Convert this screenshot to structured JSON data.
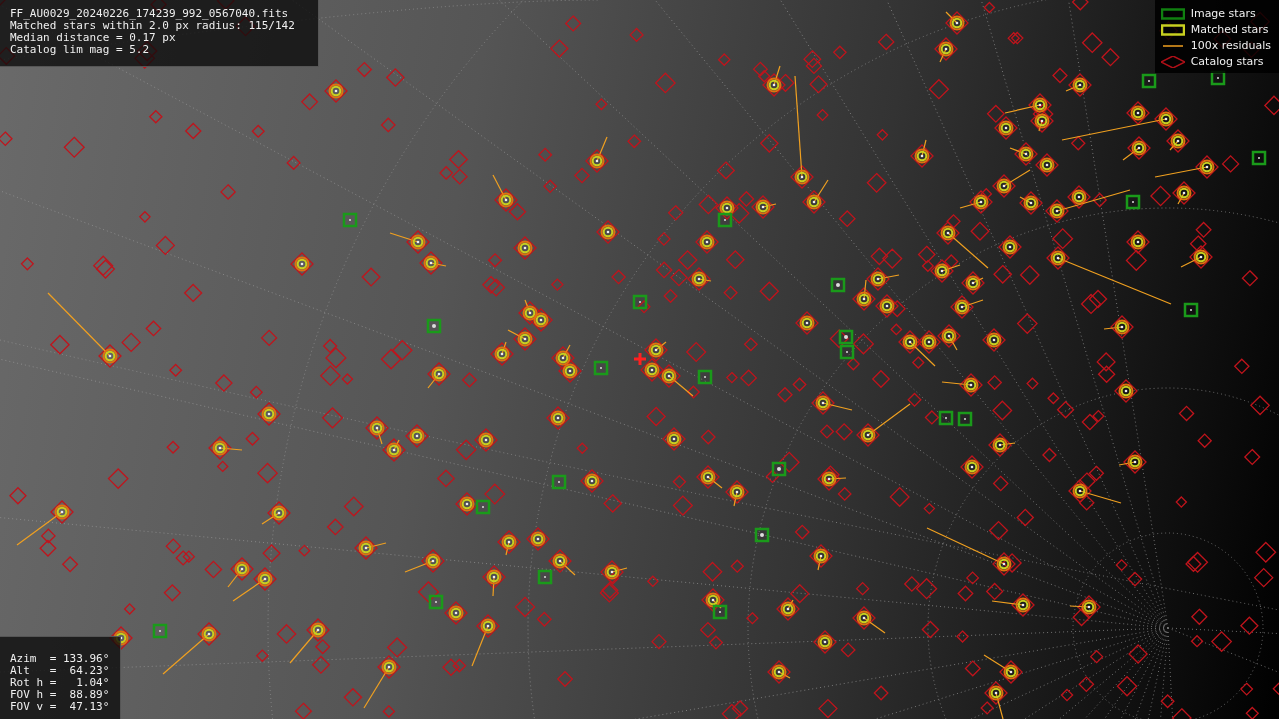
{
  "file_info": {
    "lines": [
      "FF_AU0029_20240226_174239_992_0567040.fits",
      "Matched stars within 2.0 px radius: 115/142",
      "Median distance = 0.17 px",
      "Catalog lim mag = 5.2"
    ]
  },
  "legend": [
    {
      "kind": "image",
      "label": "Image stars"
    },
    {
      "kind": "matched",
      "label": "Matched stars"
    },
    {
      "kind": "residual",
      "label": "100x residuals"
    },
    {
      "kind": "catalog",
      "label": "Catalog stars"
    }
  ],
  "pointing": {
    "lines": [
      "Azim  = 133.96°",
      "Alt   =  64.23°",
      "Rot h =   1.04°",
      "FOV h =  88.89°",
      "FOV v =  47.13°"
    ]
  }
}
